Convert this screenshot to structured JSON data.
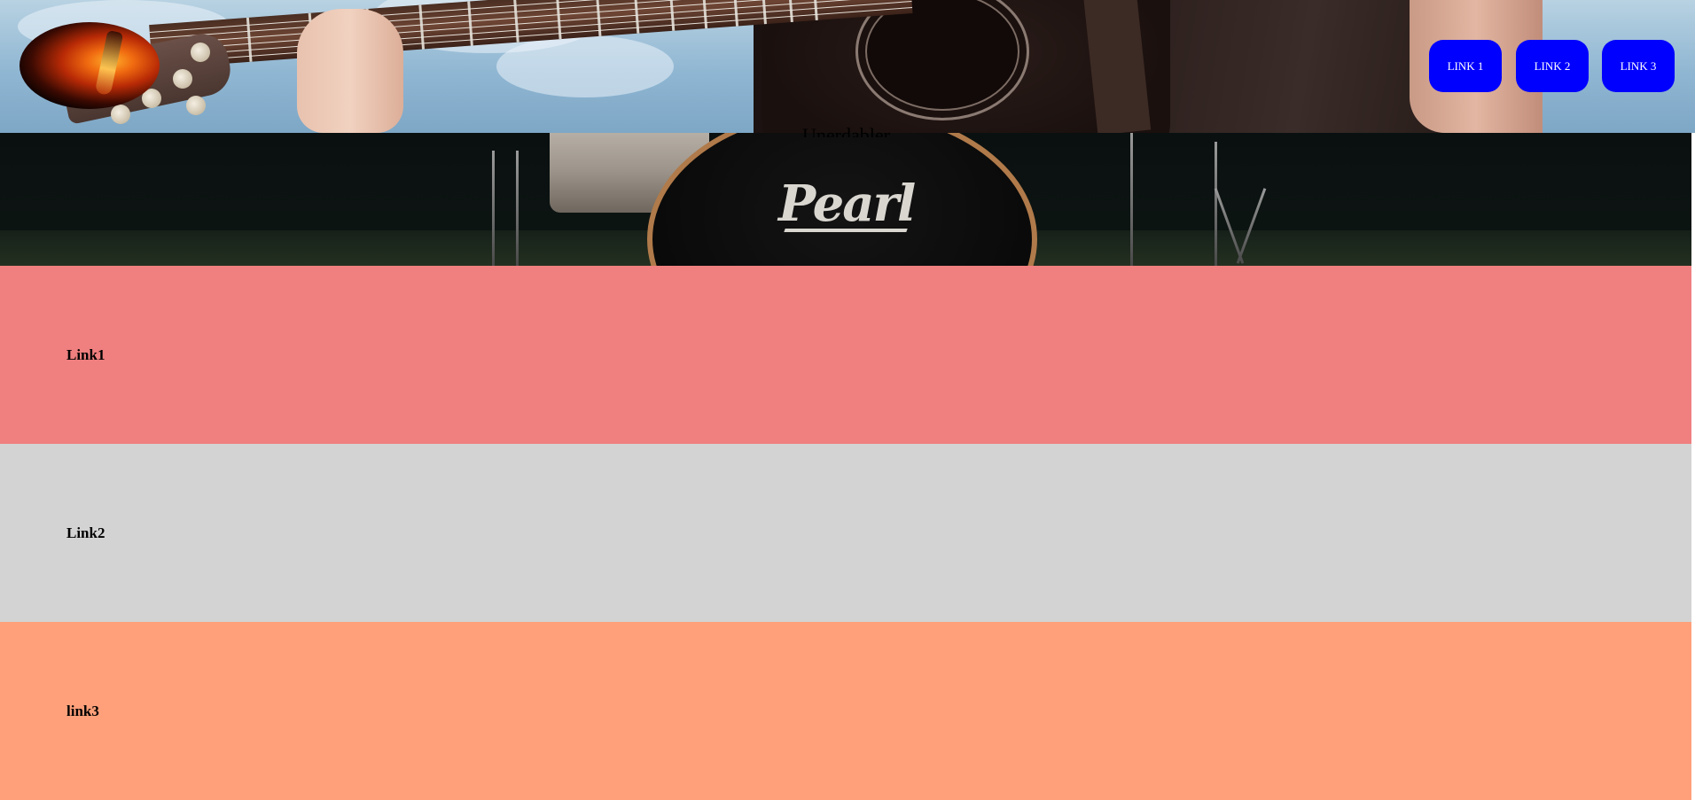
{
  "header": {
    "logo_icon": "flaming-guitar-logo-icon",
    "nav": [
      {
        "label": "LINK 1"
      },
      {
        "label": "LINK 2"
      },
      {
        "label": "LINK 3"
      }
    ],
    "nav_color": "#0000ff",
    "nav_text_color": "#ffffff"
  },
  "hero_band": {
    "title": "Unerdabler",
    "drum_brand": "Pearl"
  },
  "sections": [
    {
      "label": "Link1",
      "color": "#f07f7f"
    },
    {
      "label": "Link2",
      "color": "#d3d3d3"
    },
    {
      "label": "link3",
      "color": "#ffa07a"
    }
  ]
}
